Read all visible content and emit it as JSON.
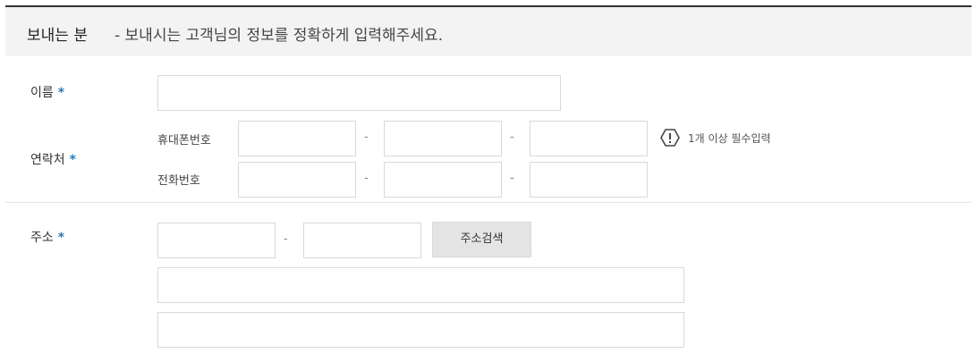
{
  "header": {
    "title": "보내는 분",
    "description": "- 보내시는 고객님의 정보를 정확하게 입력해주세요."
  },
  "name_field": {
    "label": "이름",
    "required_mark": "*"
  },
  "contact": {
    "label": "연락처",
    "required_mark": "*",
    "mobile_label": "휴대폰번호",
    "phone_label": "전화번호",
    "separator": "-",
    "notice_icon": "exclamation-hexagon-icon",
    "notice_text": "1개 이상 필수입력"
  },
  "address": {
    "label": "주소",
    "required_mark": "*",
    "separator": "-",
    "search_button": "주소검색"
  },
  "colors": {
    "accent": "#2a7ab5",
    "header_bg": "#f3f3f3",
    "border": "#d9d9d9"
  }
}
